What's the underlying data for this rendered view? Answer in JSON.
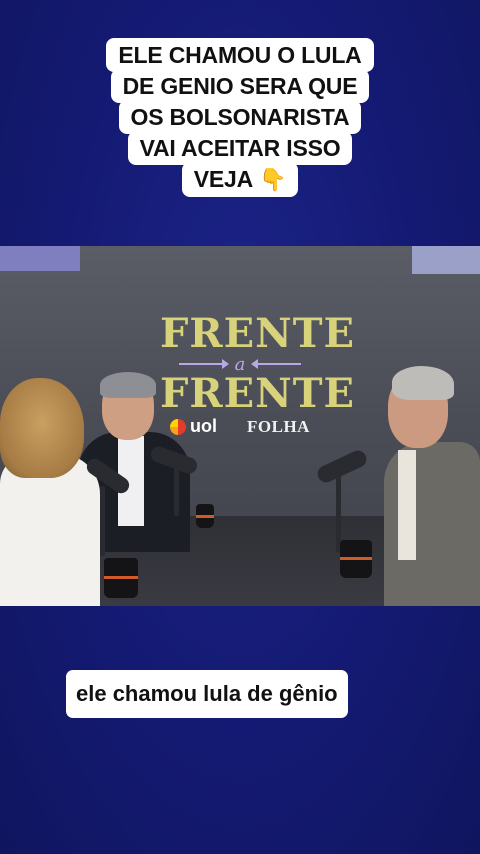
{
  "top_caption": {
    "lines": [
      "ELE CHAMOU O LULA",
      "DE GENIO SERA QUE",
      "OS BOLSONARISTA",
      "VAI ACEITAR ISSO",
      "VEJA"
    ],
    "emoji_icon": "pointing-down-hand-icon"
  },
  "video": {
    "show_logo": {
      "word_top": "FRENTE",
      "middle": "a",
      "word_bottom": "FRENTE",
      "brand_left": "uol",
      "brand_right": "FOLHA"
    }
  },
  "bottom_caption": {
    "text": "ele chamou lula de gênio"
  },
  "colors": {
    "background": "#13196e",
    "logo_text": "#d8d27a",
    "logo_accent": "#b9a7e8"
  }
}
